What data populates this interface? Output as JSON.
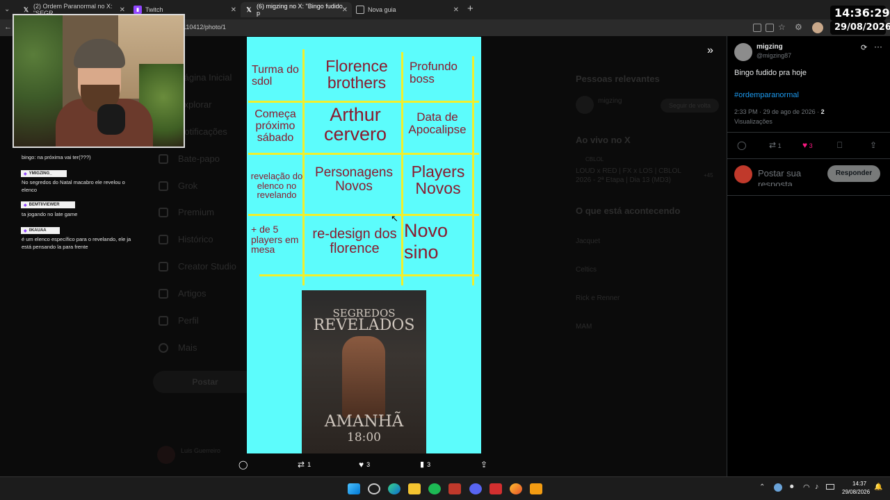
{
  "tabs": [
    {
      "icon": "x-logo-icon",
      "label": "(2) Ordem Paranormal no X: \"SEGR"
    },
    {
      "icon": "twitch-icon",
      "label": "Twitch"
    },
    {
      "icon": "x-logo-icon",
      "label": "(6) migzing no X: \"Bingo fudido p"
    },
    {
      "icon": "new-tab-icon",
      "label": "Nova guia"
    }
  ],
  "address": {
    "url": "9110412/photo/1"
  },
  "overlay": {
    "time": "14:36:29",
    "date": "29/08/2026"
  },
  "sidebar_bg": {
    "items": [
      "Página Inicial",
      "Explorar",
      "Notificações",
      "Bate-papo",
      "Grok",
      "Premium",
      "Histórico",
      "Creator Studio",
      "Artigos",
      "Perfil",
      "Mais"
    ],
    "post_button": "Postar",
    "account_name": "Luis Guerreiro"
  },
  "right_bg": {
    "relevant_heading": "Pessoas relevantes",
    "relevant_name": "migzing",
    "follow_back": "Seguir de volta",
    "live_heading": "Ao vivo no X",
    "live_source": "CBLOL",
    "live_title": "LOUD x RED | FX x LOS | CBLOL 2026 - 2ª Etapa | Dia 13 (MD3)",
    "live_count": "+45",
    "happening_heading": "O que está acontecendo",
    "trends": [
      "Jacquet",
      "Celtics",
      "Rick e Renner",
      "MAM"
    ]
  },
  "chat": [
    {
      "user": "",
      "text": "bingo: na próxima vai ter(???)"
    },
    {
      "user": "YMIGZING_",
      "text": "No segredos do Natal macabro ele revelou o elenco"
    },
    {
      "user": "BEMTIIVIEWER",
      "text": "ta jogando no late game"
    },
    {
      "user": "0KAUAA",
      "text": "é um elenco específico para o revelando, ele ja está pensando la para frente"
    }
  ],
  "bingo": {
    "cells": [
      "Turma do sdol",
      "Florence brothers",
      "Profundo boss",
      "Começa próximo sábado",
      "Arthur cervero",
      "Data de Apocalipse",
      "revelação do elenco no revelando",
      "Personagens Novos",
      "Players Novos",
      "+ de 5 players em mesa",
      "re-design dos florence",
      "Novo sino"
    ]
  },
  "poster": {
    "title_top": "SEGREDOS",
    "title_main": "REVELADOS",
    "day": "AMANHÃ",
    "time": "18:00"
  },
  "photo_actions": {
    "retweets": "1",
    "likes": "3",
    "views": "3"
  },
  "tweet": {
    "name": "migzing",
    "handle": "@migzing87",
    "text": "Bingo fudido pra hoje",
    "hashtag": "#ordemparanormal",
    "timestamp": "2:33 PM · 29 de ago de 2026 · ",
    "views_count": "2",
    "views_label": "Visualizações",
    "retweets": "1",
    "likes": "3",
    "reply_placeholder": "Postar sua resposta",
    "reply_button": "Responder"
  },
  "tray": {
    "time": "14:37",
    "date": "29/08/2026"
  },
  "colors": {
    "bingo_bg": "#5cfcfc",
    "bingo_text": "#8a1a2e",
    "grid_line": "#f2ef2a",
    "like_pink": "#f91880",
    "hashtag_blue": "#1d9bf0"
  }
}
